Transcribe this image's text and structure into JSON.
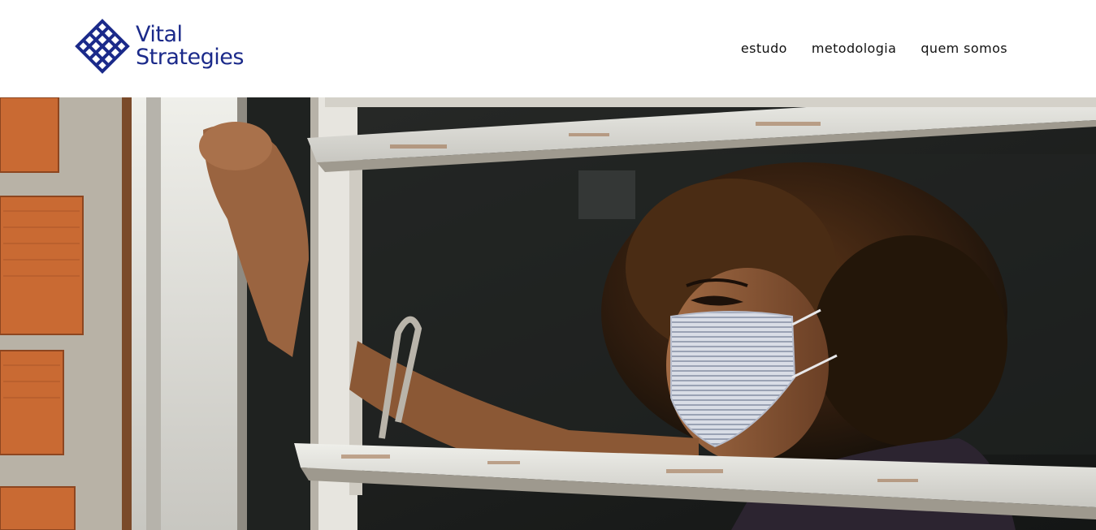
{
  "brand": {
    "line1": "Vital",
    "line2": "Strategies",
    "color": "#1b2a8a",
    "icon": "vital-strategies-logo-mark"
  },
  "nav": {
    "items": [
      {
        "label": "estudo"
      },
      {
        "label": "metodologia"
      },
      {
        "label": "quem somos"
      }
    ]
  },
  "hero": {
    "image": "woman-wearing-mask-at-window-photo"
  }
}
